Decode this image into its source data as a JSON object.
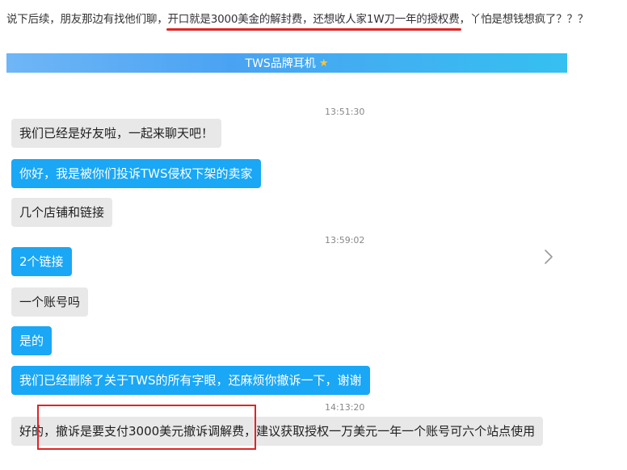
{
  "caption": {
    "prefix": "说下后续，朋友那边有找他们聊，",
    "highlight": "开口就是3000美金的解封费，还想收人家1W刀一年的授权费",
    "suffix": "，丫怕是想钱想疯了？？？",
    "highlight_color": "#e02424"
  },
  "chat": {
    "title": "TWS品牌耳机",
    "title_icon": "star-icon",
    "timestamps": [
      "13:51:30",
      "13:59:02",
      "14:13:20"
    ],
    "messages": [
      {
        "side": "left",
        "text": "我们已经是好友啦，一起来聊天吧！"
      },
      {
        "side": "right",
        "text": "你好，我是被你们投诉TWS侵权下架的卖家"
      },
      {
        "side": "right",
        "text": "几个店铺和链接"
      },
      {
        "side": "left",
        "text": "2个链接"
      },
      {
        "side": "right",
        "text": "一个账号吗"
      },
      {
        "side": "left",
        "text": "是的"
      },
      {
        "side": "left",
        "text": "我们已经删除了关于TWS的所有字眼，还麻烦你撤诉一下，谢谢"
      },
      {
        "side": "right",
        "text": "好的，撤诉是要支付3000美元撤诉调解费，建议获取授权一万美元一年一个账号可六个站点使用"
      }
    ],
    "colors": {
      "gray_bubble": "#e8e8e8",
      "blue_bubble": "#1aa7f5",
      "box": "#e02424"
    }
  }
}
